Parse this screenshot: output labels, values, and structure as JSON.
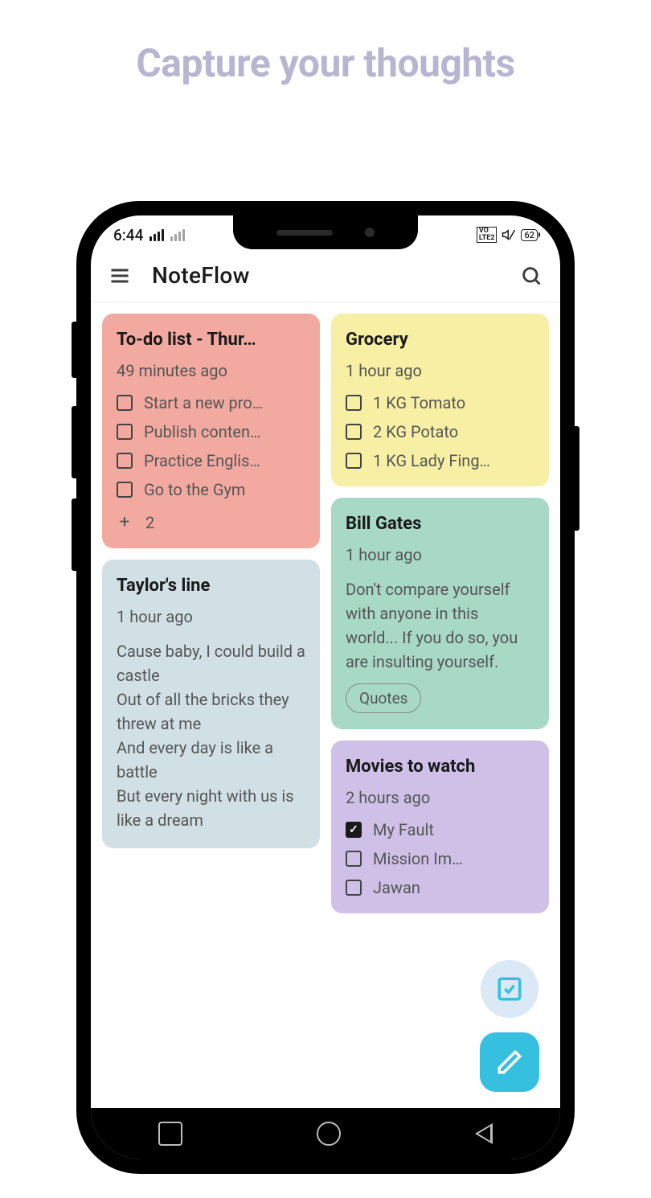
{
  "headline": "Capture your thoughts",
  "status": {
    "time": "6:44",
    "battery": "62"
  },
  "app": {
    "title": "NoteFlow"
  },
  "notes": {
    "todo": {
      "title": "To-do list - Thur…",
      "time": "49 minutes ago",
      "items": [
        "Start a new pro…",
        "Publish conten…",
        "Practice Englis…",
        "Go to the Gym"
      ],
      "more_count": "2"
    },
    "taylor": {
      "title": "Taylor's line",
      "time": "1 hour ago",
      "body": "Cause baby, I could build a castle\nOut of all the bricks they threw at me\nAnd every day is like a battle\nBut every night with us is like a dream"
    },
    "grocery": {
      "title": "Grocery",
      "time": "1 hour ago",
      "items": [
        "1 KG Tomato",
        "2 KG Potato",
        "1 KG Lady Fing…"
      ]
    },
    "billgates": {
      "title": "Bill Gates",
      "time": "1 hour ago",
      "body": "Don't compare yourself with anyone in this world... If you do so, you are insulting yourself.",
      "tag": "Quotes"
    },
    "movies": {
      "title": "Movies to watch",
      "time": "2 hours ago",
      "items": [
        {
          "label": "My Fault",
          "checked": true
        },
        {
          "label": "Mission Im…",
          "checked": false
        },
        {
          "label": "Jawan",
          "checked": false
        }
      ]
    }
  }
}
